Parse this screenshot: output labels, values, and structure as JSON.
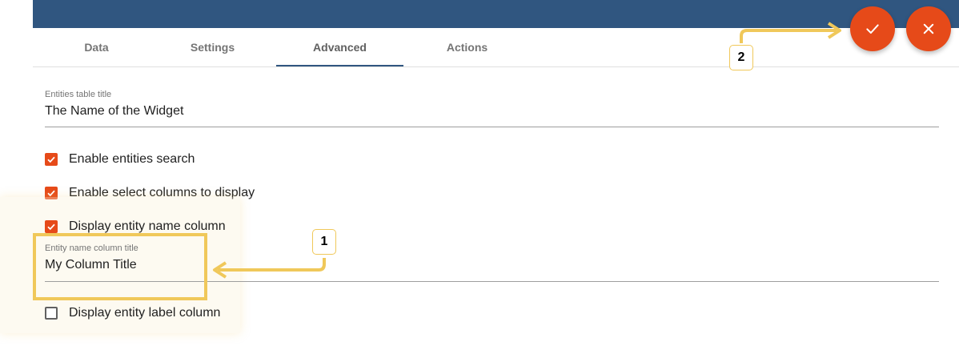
{
  "header": {
    "color": "#305680"
  },
  "tabs": [
    {
      "label": "Data",
      "active": false
    },
    {
      "label": "Settings",
      "active": false
    },
    {
      "label": "Advanced",
      "active": true
    },
    {
      "label": "Actions",
      "active": false
    }
  ],
  "form": {
    "title_field": {
      "label": "Entities table title",
      "value": "The Name of the Widget"
    },
    "checkboxes": [
      {
        "label": "Enable entities search",
        "checked": true
      },
      {
        "label": "Enable select columns to display",
        "checked": true
      },
      {
        "label": "Display entity name column",
        "checked": true
      },
      {
        "label": "Display entity label column",
        "checked": false
      }
    ],
    "name_column_field": {
      "label": "Entity name column title",
      "value": "My Column Title"
    }
  },
  "actions": {
    "apply_icon": "check-icon",
    "close_icon": "close-icon",
    "accent_color": "#e64a19"
  },
  "annotations": {
    "callout_1": "1",
    "callout_2": "2",
    "highlight_color": "#f0c85a"
  }
}
